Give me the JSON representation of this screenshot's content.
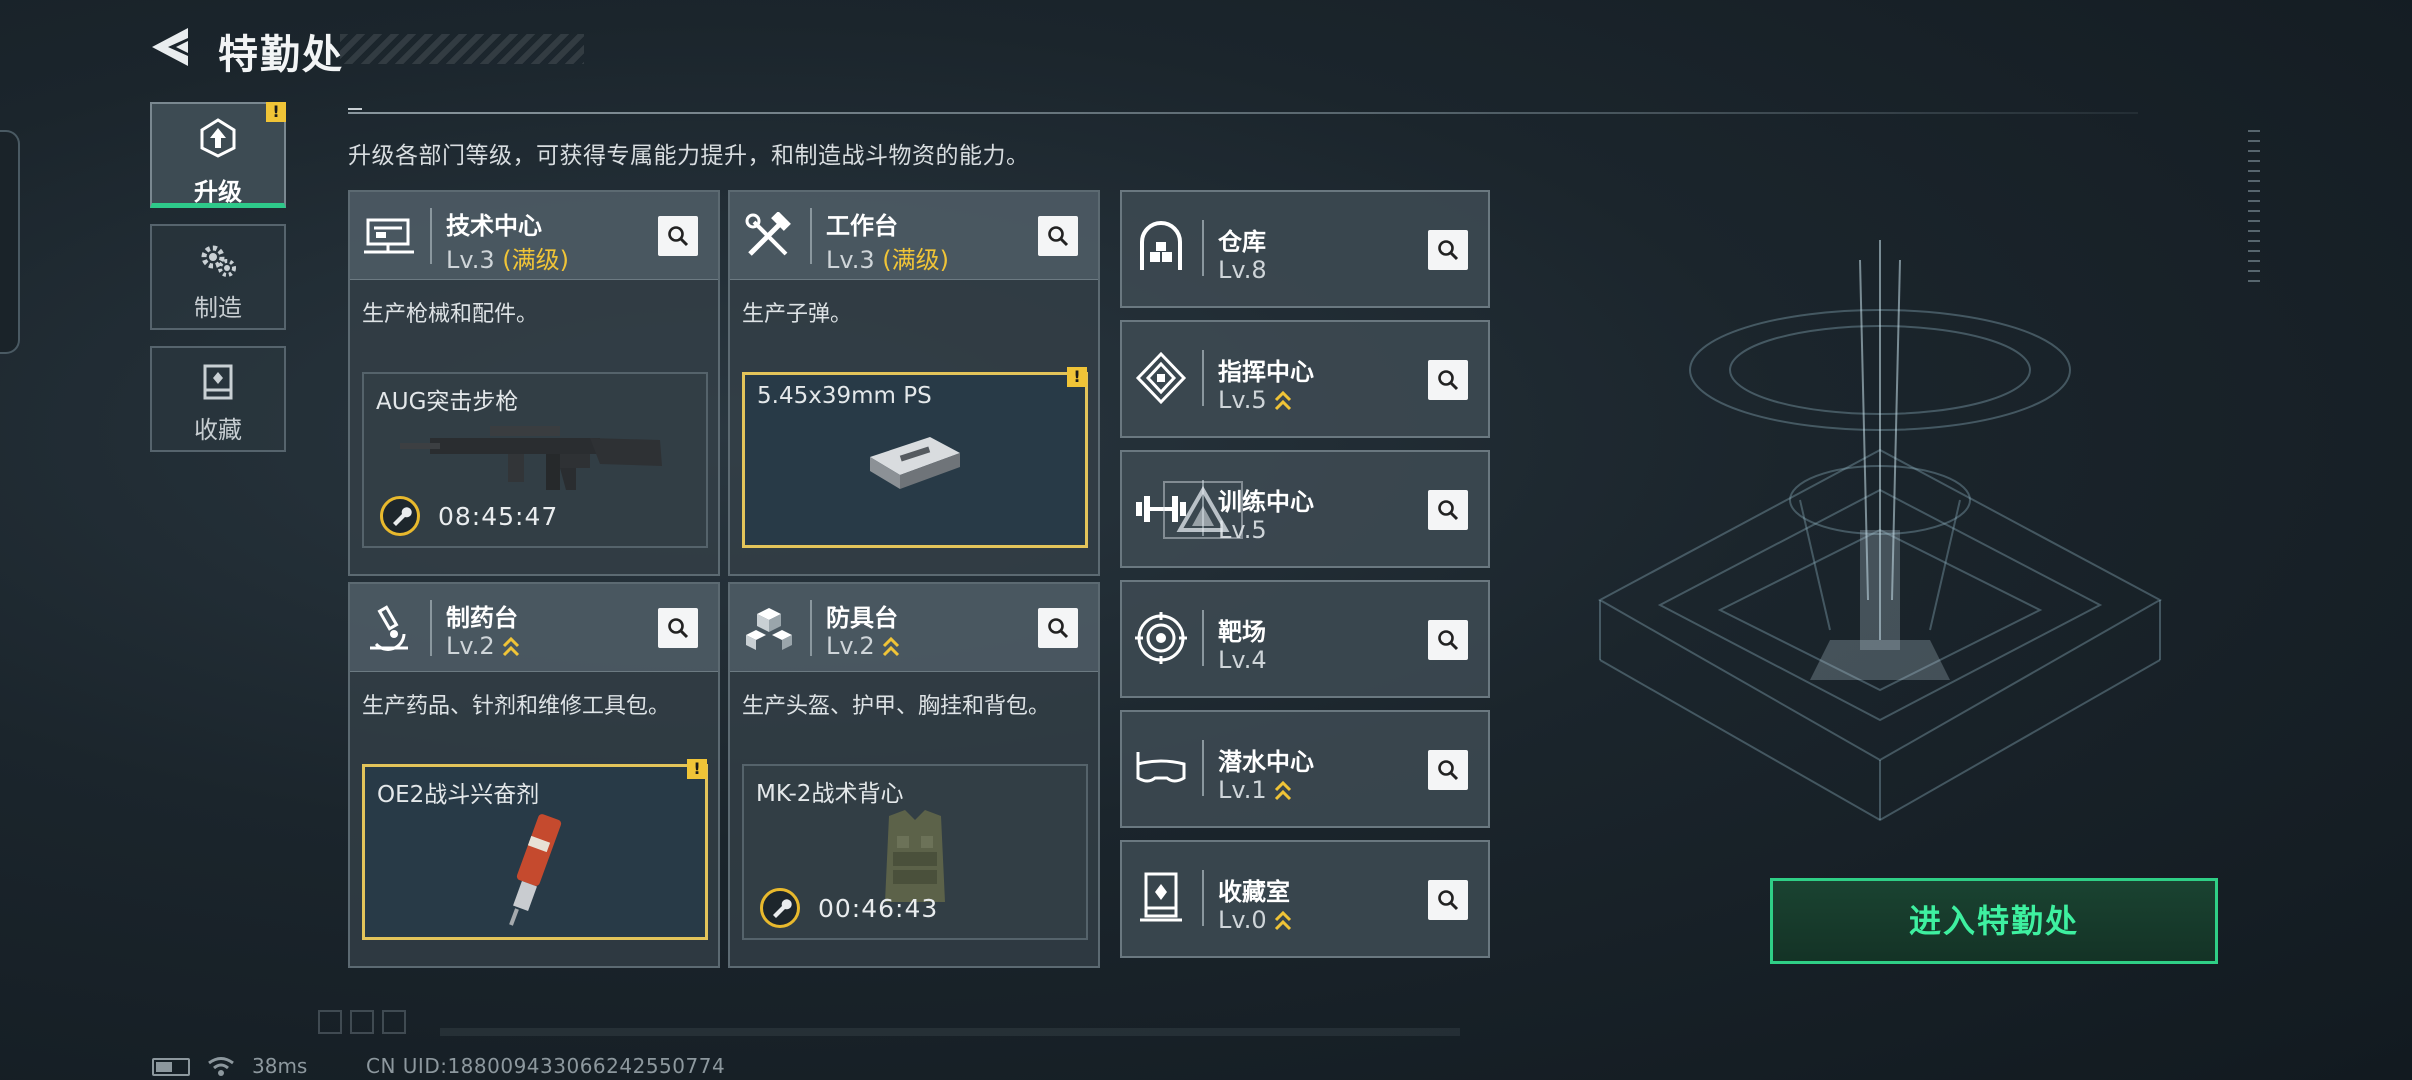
{
  "header": {
    "title": "特勤处",
    "back_icon": "back-arrow-icon"
  },
  "side_tabs": [
    {
      "label": "升级",
      "icon": "upgrade-icon",
      "active": true,
      "alert": "!"
    },
    {
      "label": "制造",
      "icon": "gears-icon",
      "active": false
    },
    {
      "label": "收藏",
      "icon": "collection-icon",
      "active": false
    }
  ],
  "description": "升级各部门等级，可获得专属能力提升，和制造战斗物资的能力。",
  "main_cards": [
    {
      "name": "技术中心",
      "level": "Lv.3",
      "status": "(满级)",
      "desc": "生产枪械和配件。",
      "item": {
        "name": "AUG突击步枪",
        "timer": "08:45:47",
        "highlight": false
      }
    },
    {
      "name": "工作台",
      "level": "Lv.3",
      "status": "(满级)",
      "desc": "生产子弹。",
      "item": {
        "name": "5.45x39mm PS",
        "alert": "!",
        "highlight": true
      }
    },
    {
      "name": "制药台",
      "level": "Lv.2",
      "desc": "生产药品、针剂和维修工具包。",
      "item": {
        "name": "OE2战斗兴奋剂",
        "alert": "!",
        "highlight": true
      }
    },
    {
      "name": "防具台",
      "level": "Lv.2",
      "desc": "生产头盔、护甲、胸挂和背包。",
      "item": {
        "name": "MK-2战术背心",
        "timer": "00:46:43",
        "highlight": false
      }
    }
  ],
  "side_cards": [
    {
      "name": "仓库",
      "level": "Lv.8",
      "upgradable": false,
      "icon": "warehouse-icon"
    },
    {
      "name": "指挥中心",
      "level": "Lv.5",
      "upgradable": true,
      "icon": "command-center-icon"
    },
    {
      "name": "训练中心",
      "level": "Lv.5",
      "upgradable": false,
      "icon": "training-center-icon"
    },
    {
      "name": "靶场",
      "level": "Lv.4",
      "upgradable": false,
      "icon": "shooting-range-icon"
    },
    {
      "name": "潜水中心",
      "level": "Lv.1",
      "upgradable": true,
      "icon": "diving-center-icon"
    },
    {
      "name": "收藏室",
      "level": "Lv.0",
      "upgradable": true,
      "icon": "collection-room-icon"
    }
  ],
  "enter_button": "进入特勤处",
  "status_bar": {
    "ping": "38ms",
    "uid": "CN UID:1880094330662425507​74"
  },
  "colors": {
    "accent_green": "#2fcf86",
    "gold": "#f0c437",
    "card_bg": "#34404a"
  }
}
